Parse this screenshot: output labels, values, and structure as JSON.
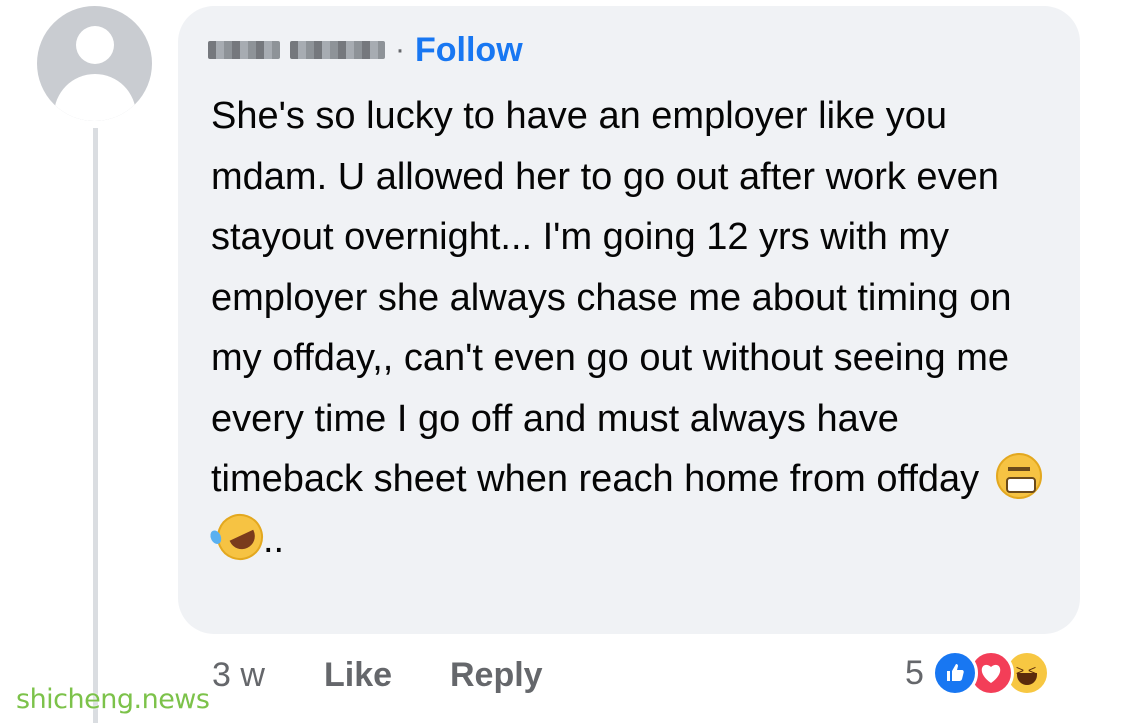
{
  "comment": {
    "follow_label": "Follow",
    "name_separator": "·",
    "text": "She's so lucky to have an employer like you mdam. U allowed her to go out after work even stayout overnight... I'm going 12 yrs with my employer she always chase me about timing on my offday,, can't even go out without seeing me every time I go off and must always have timeback sheet when reach home from offday",
    "text_suffix": "..",
    "emojis": [
      "grimacing-face",
      "rolling-on-floor-laughing"
    ]
  },
  "actions": {
    "time": "3 w",
    "like_label": "Like",
    "reply_label": "Reply"
  },
  "reactions": {
    "count": "5",
    "icons": [
      "like-icon",
      "love-icon",
      "haha-icon"
    ],
    "colors": {
      "like": "#1877f2",
      "love": "#f33e58",
      "haha": "#f7c742"
    }
  },
  "watermark": "shicheng.news",
  "colors": {
    "accent": "#1877f2",
    "bubble": "#f0f2f5",
    "muted_text": "#65676b"
  }
}
